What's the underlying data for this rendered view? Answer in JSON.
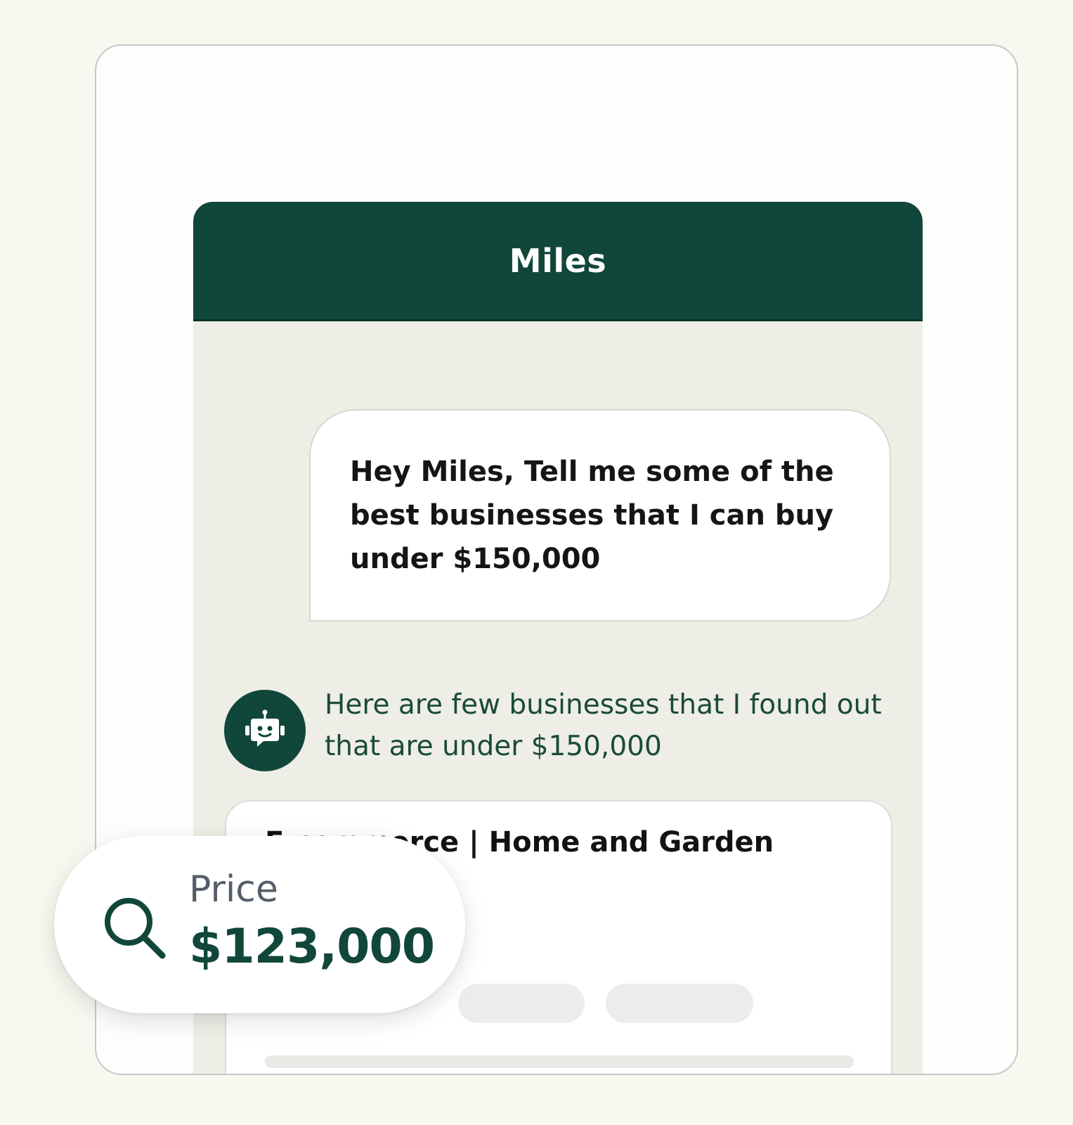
{
  "chat": {
    "title": "Miles",
    "user_message": "Hey Miles, Tell me some of the best businesses that I can buy under $150,000",
    "bot_message": "Here are few businesses that I found out that are under $150,000",
    "bot_avatar_icon": "robot-icon"
  },
  "result_card": {
    "title": "E-commerce | Home and Garden"
  },
  "price_chip": {
    "icon": "search-icon",
    "label": "Price",
    "value": "$123,000"
  },
  "colors": {
    "brand_green": "#11473a",
    "chat_background": "#eeeee6",
    "page_background": "#f8f8f0"
  }
}
